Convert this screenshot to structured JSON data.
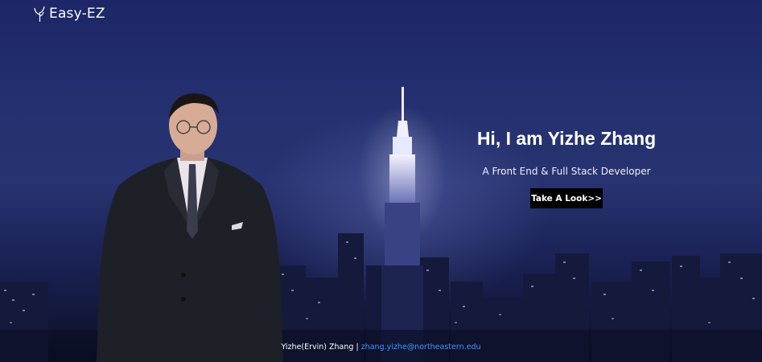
{
  "brand": {
    "name": "Easy-EZ",
    "icon": "sprout-icon"
  },
  "hero": {
    "headline": "Hi, I am Yizhe Zhang",
    "subtitle": "A Front End & Full Stack Developer",
    "cta_label": "Take A Look>>"
  },
  "footer": {
    "name": "Yizhe(Ervin) Zhang",
    "separator": "|",
    "email": "zhang.yizhe@northeastern.edu"
  },
  "colors": {
    "background": "#1d2667",
    "button": "#000000",
    "link": "#3f95ff"
  }
}
